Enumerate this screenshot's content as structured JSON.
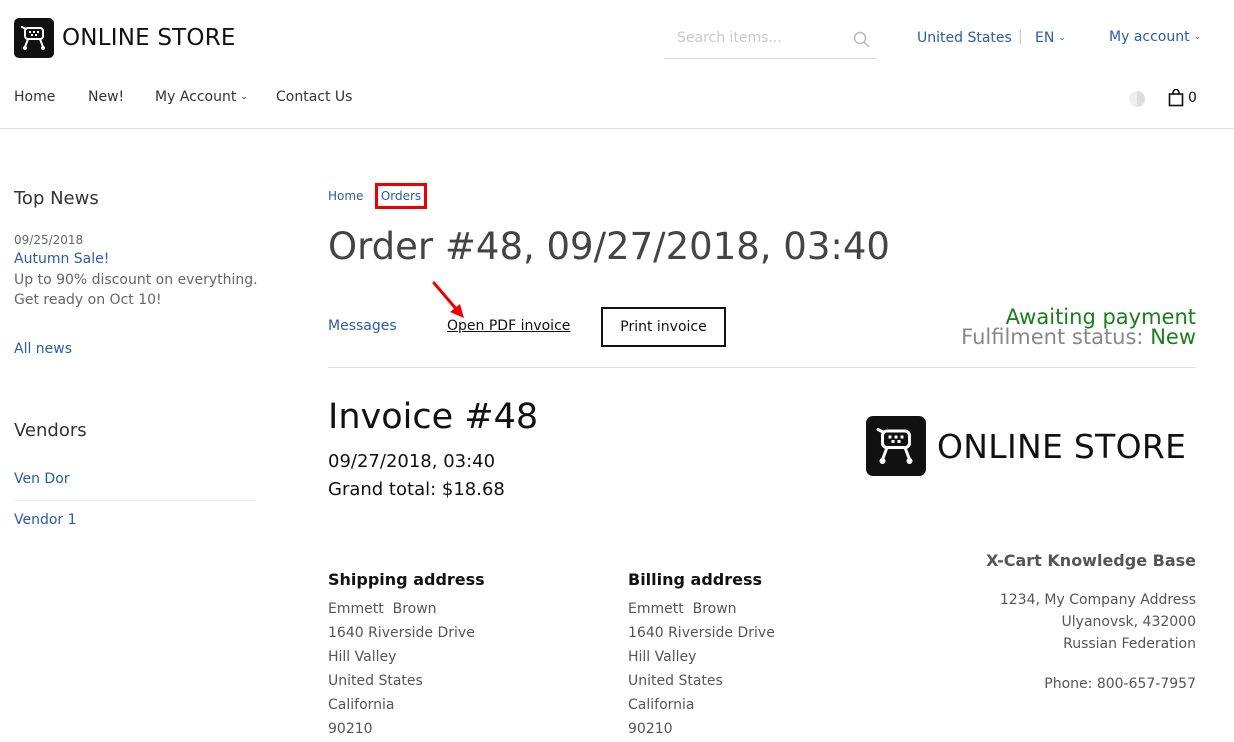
{
  "header": {
    "logo_text": "ONLINE STORE",
    "search_placeholder": "Search items...",
    "country": "United States",
    "separator": "|",
    "language": "EN",
    "account": "My account",
    "cart_count": "0"
  },
  "nav": [
    "Home",
    "New!",
    "My Account",
    "Contact Us"
  ],
  "sidebar": {
    "news_heading": "Top News",
    "news_date": "09/25/2018",
    "news_title": "Autumn Sale!",
    "news_desc": "Up to 90% discount on everything. Get ready on Oct 10!",
    "all_news": "All news",
    "vendors_heading": "Vendors",
    "vendors": [
      "Ven Dor",
      "Vendor 1"
    ]
  },
  "breadcrumb": {
    "home": "Home",
    "orders": "Orders"
  },
  "order": {
    "title": "Order #48, 09/27/2018, 03:40",
    "messages": "Messages",
    "pdf": "Open PDF invoice",
    "print": "Print invoice",
    "payment_status": "Awaiting payment",
    "fulfilment_label": "Fulfilment status:",
    "fulfilment_value": "New"
  },
  "invoice": {
    "title": "Invoice #48",
    "date": "09/27/2018, 03:40",
    "total": "Grand total: $18.68",
    "logo_text": "ONLINE STORE",
    "shipping_heading": "Shipping address",
    "billing_heading": "Billing address",
    "shipping": [
      "Emmett  Brown",
      "1640 Riverside Drive",
      "Hill Valley",
      "United States",
      "California",
      "90210"
    ],
    "billing": [
      "Emmett  Brown",
      "1640 Riverside Drive",
      "Hill Valley",
      "United States",
      "California",
      "90210"
    ],
    "company_name": "X-Cart Knowledge Base",
    "company_address": [
      "1234, My Company Address",
      "Ulyanovsk, 432000",
      "Russian Federation"
    ],
    "company_phone": "Phone: 800-657-7957"
  },
  "colors": {
    "link": "#2b5ba8",
    "status_green": "#1a7e1a",
    "highlight_red": "#e00000"
  }
}
